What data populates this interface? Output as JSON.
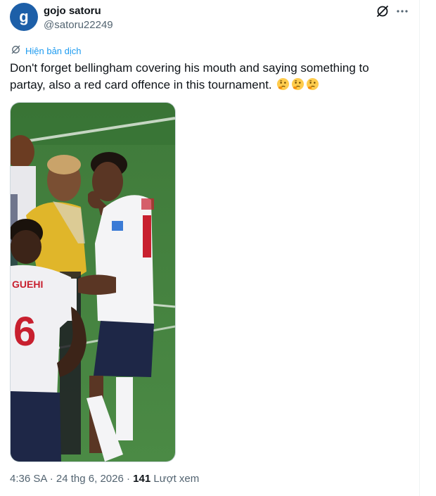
{
  "author": {
    "avatar_letter": "g",
    "display_name": "gojo satoru",
    "handle": "@satoru22249"
  },
  "translate_label": "Hiện bản dịch",
  "tweet": {
    "text": "Don't forget bellingham covering his mouth and saying something to partay, also a red card offence in this tournament.",
    "emojis": [
      "thinking-face",
      "thinking-face",
      "thinking-face"
    ]
  },
  "media": {
    "shirt_name": "GUEHI",
    "shirt_number": "6"
  },
  "meta": {
    "time": "4:36 SA",
    "separator": "·",
    "date": "24 thg 6, 2026",
    "views_count": "141",
    "views_label": "Lượt xem"
  },
  "colors": {
    "accent": "#1d9bf0",
    "text": "#0f1419",
    "secondary": "#536471",
    "avatar_bg": "#1d5fa8"
  },
  "icons": {
    "grok": "grok-icon",
    "more": "more-icon",
    "translate": "translate-icon"
  }
}
